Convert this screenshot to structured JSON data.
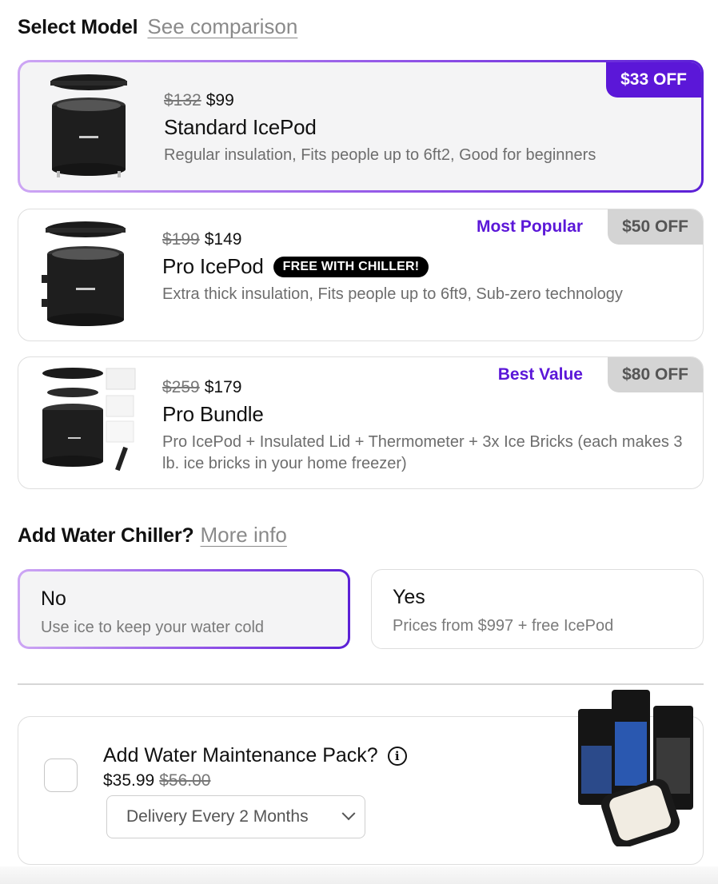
{
  "select_model": {
    "heading": "Select Model",
    "link": "See comparison"
  },
  "models": [
    {
      "price_old": "$132",
      "price": "$99",
      "title": "Standard IcePod",
      "tag": "",
      "desc": "Regular insulation, Fits people up to 6ft2, Good for beginners",
      "tagline": "",
      "badge": "$33 OFF",
      "selected": true
    },
    {
      "price_old": "$199",
      "price": "$149",
      "title": "Pro IcePod",
      "tag": "FREE WITH CHILLER!",
      "desc": "Extra thick insulation, Fits people up to 6ft9, Sub-zero technology",
      "tagline": "Most Popular",
      "badge": "$50 OFF",
      "selected": false
    },
    {
      "price_old": "$259",
      "price": "$179",
      "title": "Pro Bundle",
      "tag": "",
      "desc": "Pro IcePod + Insulated Lid + Thermometer + 3x Ice Bricks (each makes 3 lb. ice bricks in your home freezer)",
      "tagline": "Best Value",
      "badge": "$80 OFF",
      "selected": false
    }
  ],
  "chiller": {
    "heading": "Add Water Chiller?",
    "link": "More info",
    "options": [
      {
        "title": "No",
        "sub": "Use ice to keep your water cold",
        "selected": true
      },
      {
        "title": "Yes",
        "sub": "Prices from $997 + free IcePod",
        "selected": false
      }
    ]
  },
  "maintenance": {
    "title": "Add Water Maintenance Pack?",
    "price": "$35.99",
    "price_old": "$56.00",
    "checked": false,
    "delivery_selected": "Delivery Every 2 Months",
    "icons": {
      "info": "info-icon",
      "dropdown": "chevron-down-icon"
    }
  },
  "colors": {
    "accent": "#5b17d8",
    "badge_grey": "#d4d4d4",
    "selected_bg": "#f4f4f5"
  }
}
